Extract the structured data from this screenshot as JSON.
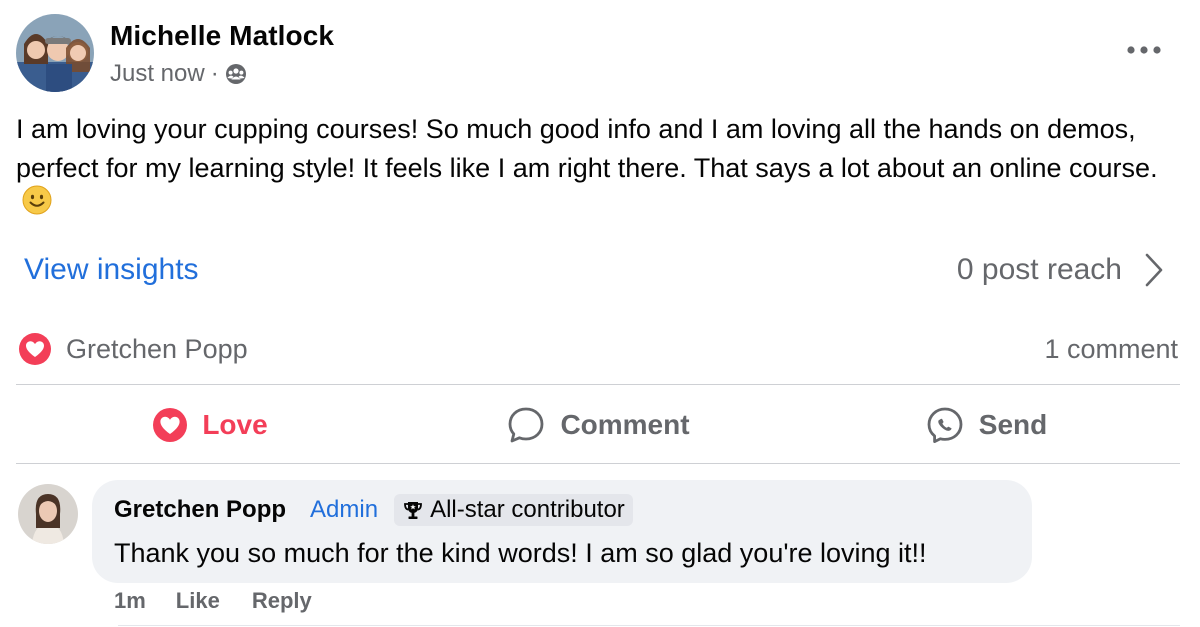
{
  "post": {
    "author": "Michelle Matlock",
    "time": "Just now",
    "separator": "·",
    "audience_icon": "group-icon",
    "more_icon": "more-horizontal-icon",
    "text": "I am loving your cupping courses! So much good info and I am loving all the hands on demos, perfect for my learning style! It feels like I am right there. That says a lot about an online course.",
    "emoji": "smiling-face-icon"
  },
  "insights": {
    "view_label": "View insights",
    "reach_label": "0 post reach",
    "reach_icon": "chevron-right-icon"
  },
  "reactions": {
    "icon": "love-reaction-icon",
    "reactor": "Gretchen Popp",
    "comment_count": "1 comment"
  },
  "actions": {
    "love_label": "Love",
    "comment_label": "Comment",
    "send_label": "Send"
  },
  "comment": {
    "author": "Gretchen Popp",
    "role_badge": "Admin",
    "contributor_badge": "All-star contributor",
    "text": "Thank you so much for the kind words! I am so glad you're loving it!!",
    "time": "1m",
    "like_label": "Like",
    "reply_label": "Reply"
  },
  "colors": {
    "link_blue": "#216fdb",
    "love_red": "#f33e58",
    "secondary_text": "#65676b",
    "bubble_bg": "#f0f2f5"
  }
}
